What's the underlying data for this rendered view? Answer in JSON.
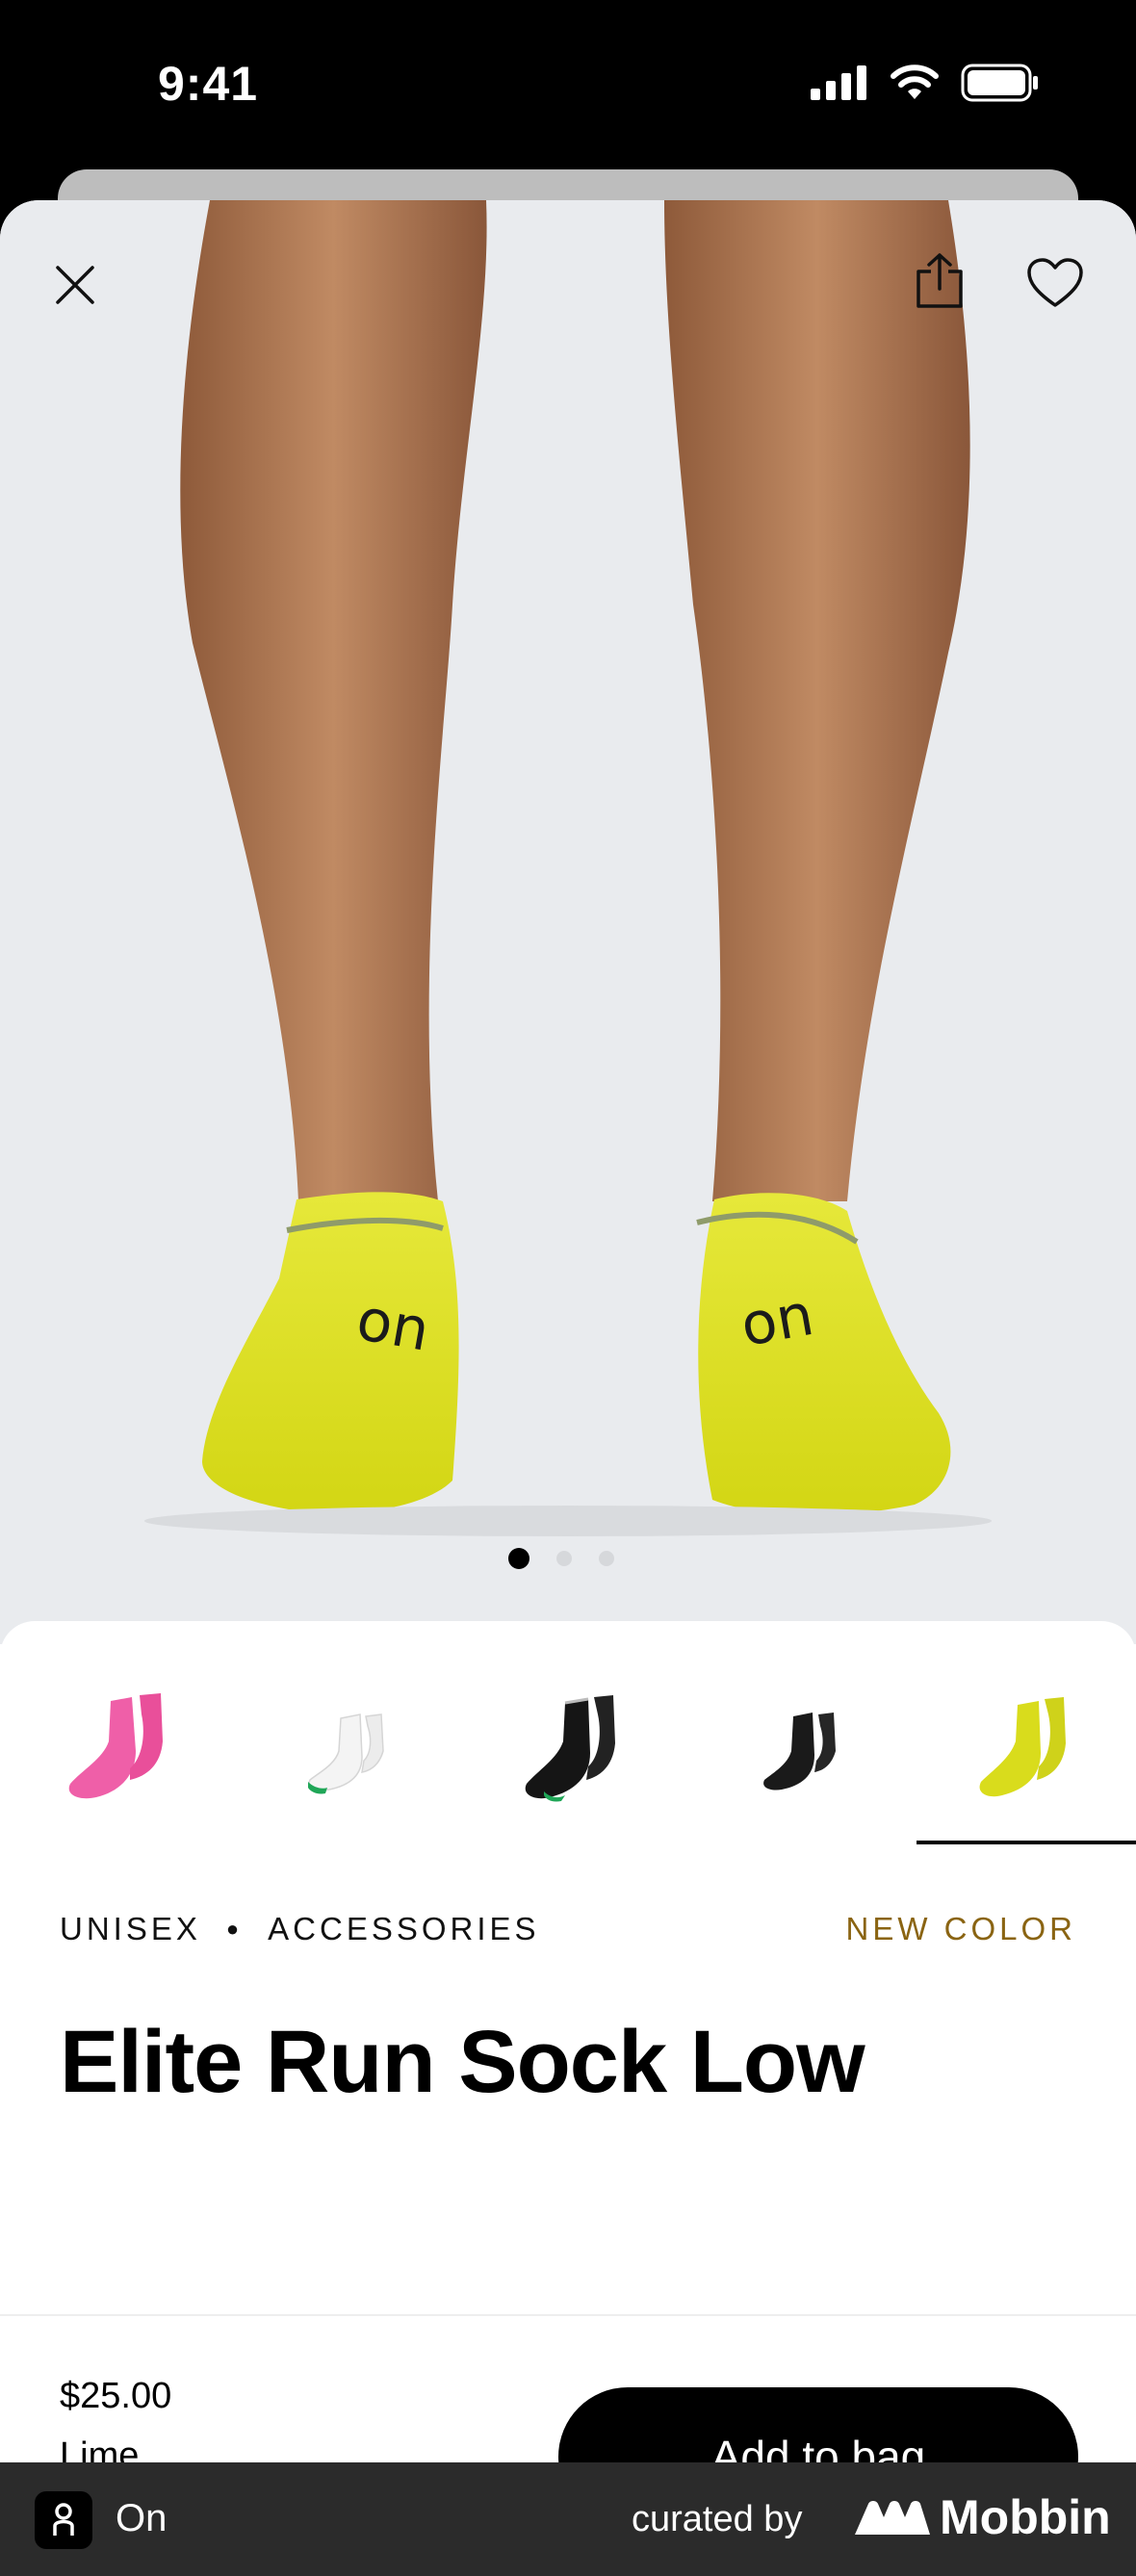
{
  "status_bar": {
    "time": "9:41",
    "icons": [
      "signal-icon",
      "wifi-icon",
      "battery-icon"
    ]
  },
  "header": {
    "close_icon": "close-icon",
    "share_icon": "share-icon",
    "favorite_icon": "heart-icon"
  },
  "carousel": {
    "pages": 3,
    "current": 1
  },
  "swatches": [
    {
      "color": "Pink",
      "hex": "#ef5fa8",
      "selected": false
    },
    {
      "color": "White",
      "hex": "#f4f4f4",
      "selected": false
    },
    {
      "color": "Black",
      "hex": "#151515",
      "selected": false
    },
    {
      "color": "Black",
      "hex": "#1a1a1a",
      "selected": false
    },
    {
      "color": "Lime",
      "hex": "#d9dc1c",
      "selected": true
    }
  ],
  "product": {
    "gender": "UNISEX",
    "category": "ACCESSORIES",
    "badge": "NEW COLOR",
    "title": "Elite Run Sock Low",
    "price": "$25.00",
    "variant": "Lime"
  },
  "actions": {
    "add_to_bag": "Add to bag"
  },
  "footer": {
    "app_name": "On",
    "curated_by": "curated by",
    "brand": "Mobbin"
  },
  "colors": {
    "badge": "#8a6412",
    "sock": "#e0e21f",
    "skin": "#b07a55",
    "background": "#e9ebee"
  }
}
